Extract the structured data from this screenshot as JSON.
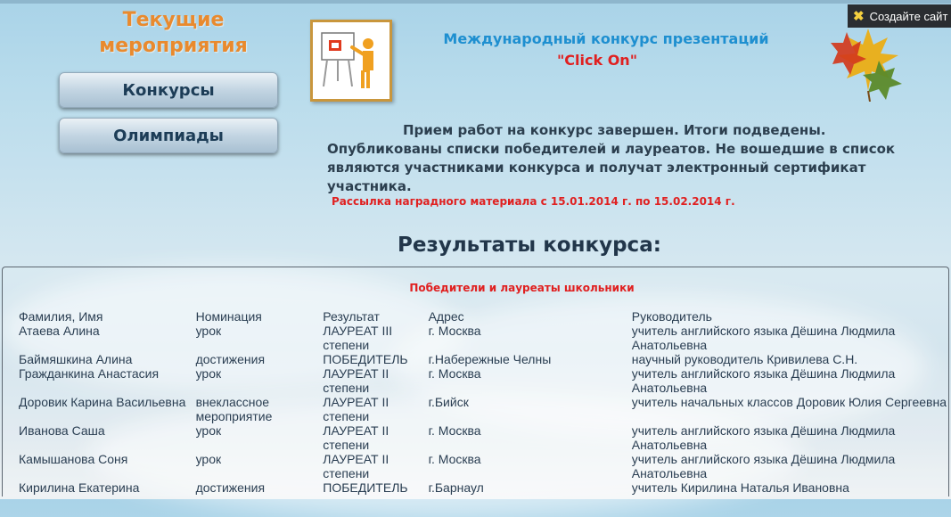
{
  "sidebar": {
    "title_line1": "Текущие",
    "title_line2": "мероприятия",
    "buttons": [
      {
        "label": "Конкурсы"
      },
      {
        "label": "Олимпиады"
      }
    ]
  },
  "header": {
    "contest_title": "Международный конкурс презентаций",
    "contest_name": "\"Click On\""
  },
  "create_site": {
    "label": "Создайте сайт",
    "icon": "close-x-icon"
  },
  "announcement": {
    "text": "Прием работ на конкурс завершен. Итоги подведены. Опубликованы списки победителей и лауреатов. Не вошедшие в список являются участниками конкурса и получат электронный сертификат участника.",
    "mailing": "Рассылка наградного материала с 15.01.2014 г. по 15.02.2014 г."
  },
  "results": {
    "title": "Результаты конкурса:",
    "caption": "Победители и лауреаты школьники",
    "columns": [
      "Фамилия, Имя",
      "Номинация",
      "Результат",
      "Адрес",
      "Руководитель"
    ],
    "rows": [
      [
        "Атаева Алина",
        "урок",
        "ЛАУРЕАТ III степени",
        " г. Москва",
        "учитель английского языка Дёшина Людмила Анатольевна"
      ],
      [
        "Баймяшкина Алина",
        "достижения",
        "ПОБЕДИТЕЛЬ",
        "г.Набережные Челны",
        "научный руководитель Кривилева С.Н."
      ],
      [
        "Гражданкина Анастасия",
        "урок",
        "ЛАУРЕАТ II степени",
        " г. Москва",
        "учитель английского языка Дёшина Людмила Анатольевна"
      ],
      [
        "Доровик Карина Васильевна",
        "внеклассное мероприятие",
        "ЛАУРЕАТ II степени",
        "г.Бийск",
        "учитель начальных классов Доровик Юлия Сергеевна"
      ],
      [
        "Иванова Саша",
        "урок",
        "ЛАУРЕАТ II степени",
        " г. Москва",
        "учитель английского языка Дёшина Людмила Анатольевна"
      ],
      [
        "Камышанова Соня",
        "урок",
        "ЛАУРЕАТ II степени",
        " г. Москва",
        "учитель английского языка Дёшина Людмила Анатольевна"
      ],
      [
        "Кирилина Екатерина",
        "достижения",
        "ПОБЕДИТЕЛЬ",
        "г.Барнаул",
        "учитель Кирилина Наталья Ивановна"
      ]
    ]
  },
  "colors": {
    "accent_orange": "#e98a2e",
    "title_blue": "#1e8fd0",
    "alert_red": "#e02020",
    "text_dark": "#2c3f4f"
  }
}
